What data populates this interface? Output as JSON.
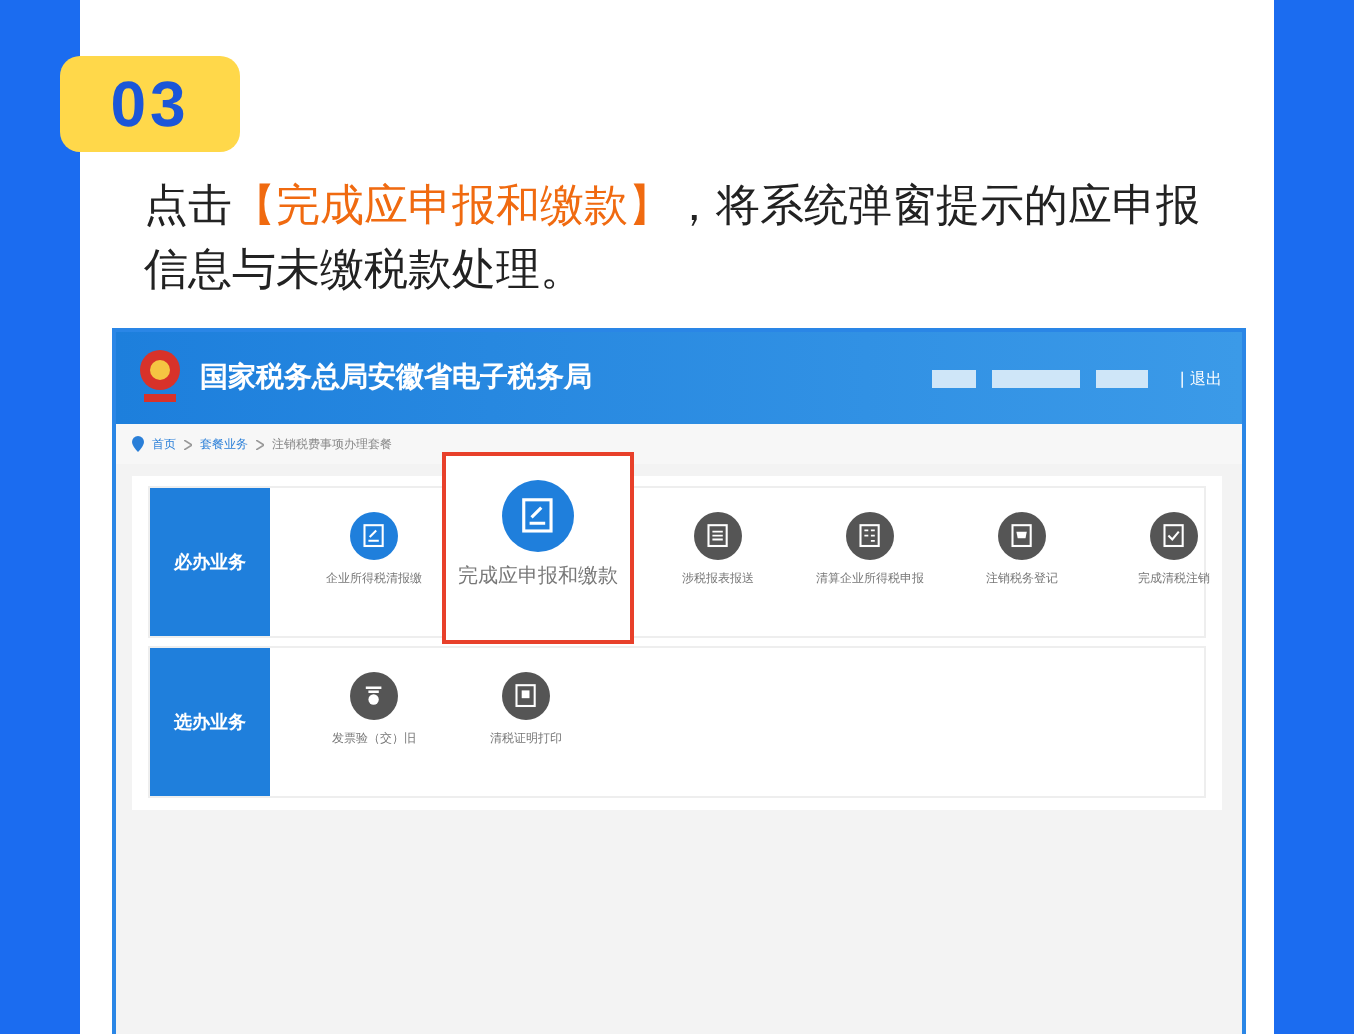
{
  "step_badge": "03",
  "instruction": {
    "before": "点击",
    "highlight": "【完成应申报和缴款】",
    "after": "，将系统弹窗提示的应申报信息与未缴税款处理。"
  },
  "screenshot": {
    "header": {
      "title": "国家税务总局安徽省电子税务局",
      "logout": "| 退出"
    },
    "breadcrumb": [
      "首页",
      "套餐业务",
      "注销税费事项办理套餐"
    ],
    "sections": [
      {
        "label": "必办业务",
        "items": [
          {
            "label": "企业所得税清报缴",
            "kind": "edit",
            "active": true,
            "highlighted": false
          },
          {
            "label": "完成应申报和缴款",
            "kind": "edit",
            "active": true,
            "highlighted": true
          },
          {
            "label": "涉税报表报送",
            "kind": "list",
            "active": false,
            "highlighted": false
          },
          {
            "label": "清算企业所得税申报",
            "kind": "calc",
            "active": false,
            "highlighted": false
          },
          {
            "label": "注销税务登记",
            "kind": "cart",
            "active": false,
            "highlighted": false
          },
          {
            "label": "完成清税注销",
            "kind": "check",
            "active": false,
            "highlighted": false
          }
        ]
      },
      {
        "label": "选办业务",
        "items": [
          {
            "label": "发票验（交）旧",
            "kind": "stamp",
            "active": false,
            "highlighted": false
          },
          {
            "label": "清税证明打印",
            "kind": "doc",
            "active": false,
            "highlighted": false
          }
        ]
      }
    ]
  }
}
